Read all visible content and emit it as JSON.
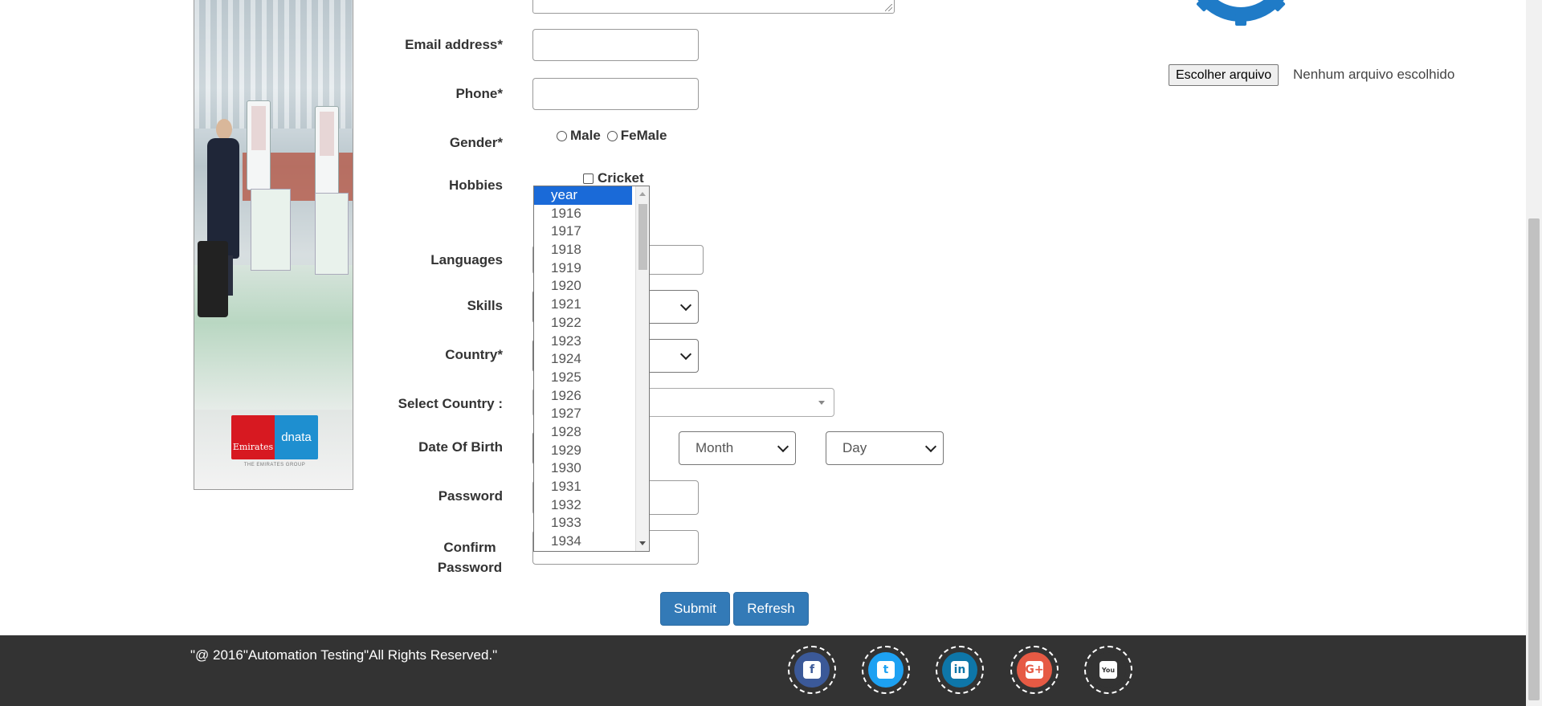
{
  "form": {
    "email_label": "Email address*",
    "phone_label": "Phone*",
    "gender_label": "Gender*",
    "gender_options": [
      "Male",
      "FeMale"
    ],
    "hobbies_label": "Hobbies",
    "hobby_first": "Cricket",
    "languages_label": "Languages",
    "skills_label": "Skills",
    "country_label": "Country*",
    "select_country_label": "Select Country :",
    "dob_label": "Date Of Birth",
    "month_placeholder": "Month",
    "day_placeholder": "Day",
    "password_label": "Password",
    "confirm_password_label": "Confirm Password",
    "submit_label": "Submit",
    "refresh_label": "Refresh"
  },
  "year_dropdown": {
    "selected": "year",
    "options": [
      "year",
      "1916",
      "1917",
      "1918",
      "1919",
      "1920",
      "1921",
      "1922",
      "1923",
      "1924",
      "1925",
      "1926",
      "1927",
      "1928",
      "1929",
      "1930",
      "1931",
      "1932",
      "1933",
      "1934"
    ]
  },
  "file_upload": {
    "button_label": "Escolher arquivo",
    "status_text": "Nenhum arquivo escolhido"
  },
  "banner": {
    "brand_left": "Emirates",
    "brand_right": "dnata",
    "tagline": "THE EMIRATES GROUP"
  },
  "footer": {
    "copyright": "\"@ 2016\"Automation Testing\"All Rights Reserved.\"",
    "social": [
      {
        "name": "facebook-icon",
        "glyph": "f",
        "color": "#3b5998"
      },
      {
        "name": "twitter-icon",
        "glyph": "t",
        "color": "#1da1f2"
      },
      {
        "name": "linkedin-icon",
        "glyph": "in",
        "color": "#0e76a8"
      },
      {
        "name": "googleplus-icon",
        "glyph": "G+",
        "color": "#e65a44"
      },
      {
        "name": "youtube-icon",
        "glyph": "You",
        "color": "#333333"
      }
    ]
  },
  "colors": {
    "primary_button": "#337ab7",
    "selected_option": "#1a6ad8",
    "footer_bg": "#333333"
  }
}
